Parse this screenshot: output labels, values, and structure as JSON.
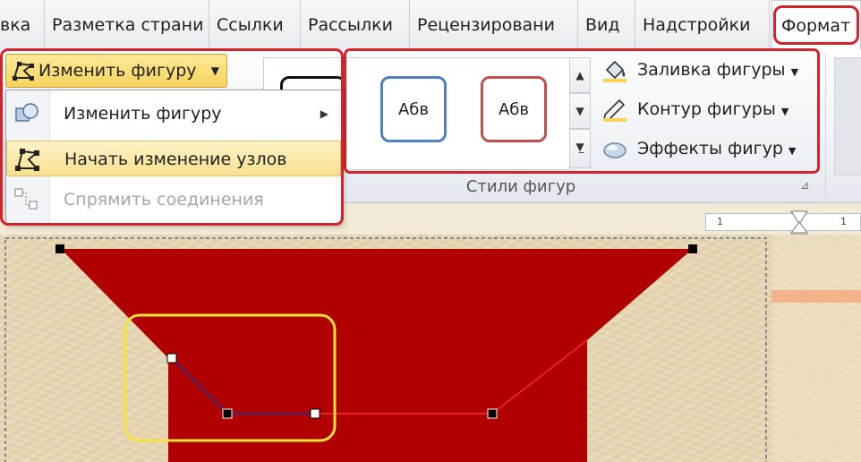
{
  "tabs": [
    "вка",
    "Разметка страни",
    "Ссылки",
    "Рассылки",
    "Рецензировани",
    "Вид",
    "Надстройки",
    "Формат"
  ],
  "ribbon": {
    "edit_shape_button": "Изменить фигуру",
    "shape_styles": [
      {
        "label": "",
        "border_color": "#111111"
      },
      {
        "label": "Абв",
        "border_color": "#4f81bd"
      },
      {
        "label": "Абв",
        "border_color": "#c0504d"
      }
    ],
    "commands": {
      "fill": "Заливка фигуры",
      "outline": "Контур фигуры",
      "effects": "Эффекты фигур"
    },
    "group_label": "Стили фигур"
  },
  "menu": {
    "items": [
      {
        "label": "Изменить фигуру",
        "has_submenu": true,
        "highlighted": false,
        "disabled": false
      },
      {
        "label": "Начать изменение узлов",
        "has_submenu": false,
        "highlighted": true,
        "disabled": false
      },
      {
        "label": "Спрямить соединения",
        "has_submenu": false,
        "highlighted": false,
        "disabled": true
      }
    ]
  },
  "ruler": {
    "marks": [
      "1",
      "1"
    ]
  },
  "colors": {
    "highlight_red": "#d3242e",
    "shape_fill": "#b00000",
    "selection_yellow": "#f5e33a",
    "button_gold": "#f7d35c"
  }
}
